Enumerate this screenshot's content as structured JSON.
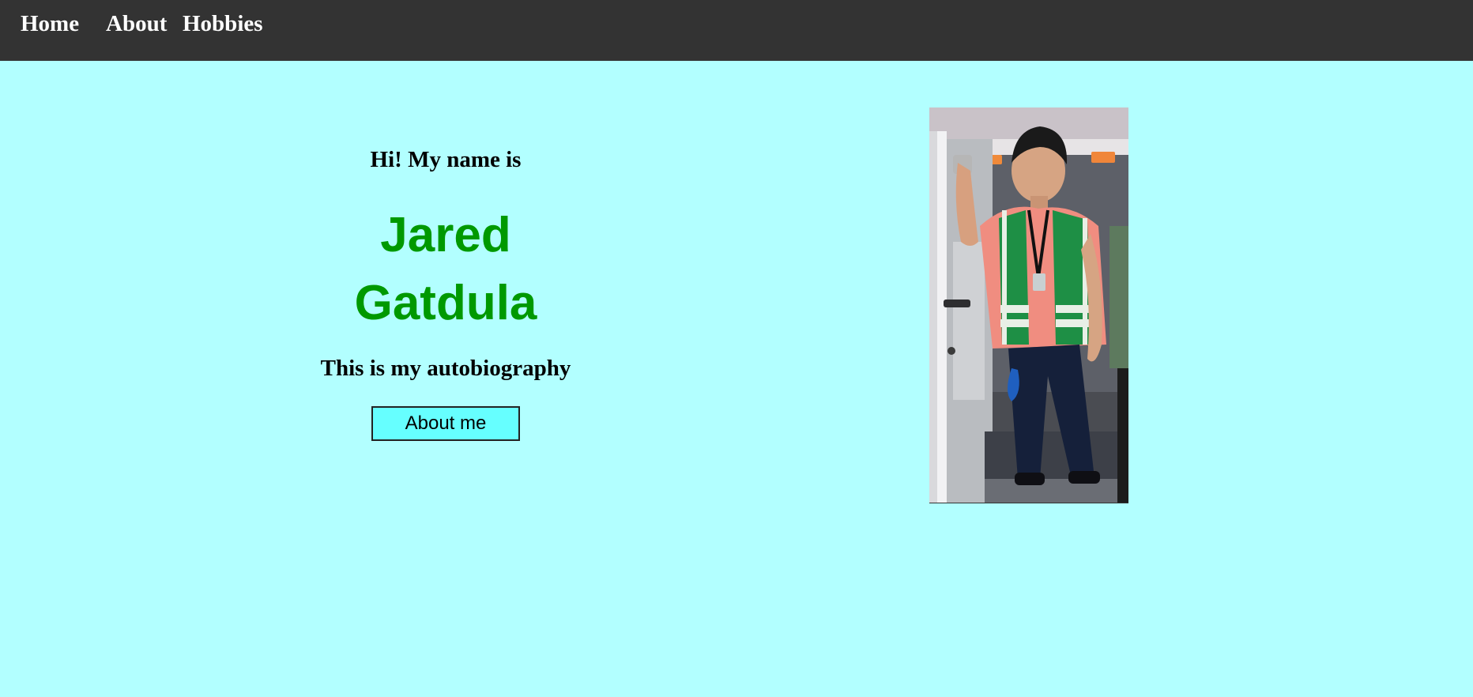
{
  "nav": {
    "home": "Home",
    "about": "About",
    "hobbies": "Hobbies"
  },
  "hero": {
    "greeting": "Hi! My name is",
    "name_first": "Jared",
    "name_last": "Gatdula",
    "subtitle": "This is my autobiography",
    "button_label": "About me"
  },
  "colors": {
    "background": "#b2ffff",
    "navbar": "#333333",
    "name_green": "#009900",
    "button_bg": "#66ffff"
  },
  "photo": {
    "icon": "portrait-photo"
  }
}
